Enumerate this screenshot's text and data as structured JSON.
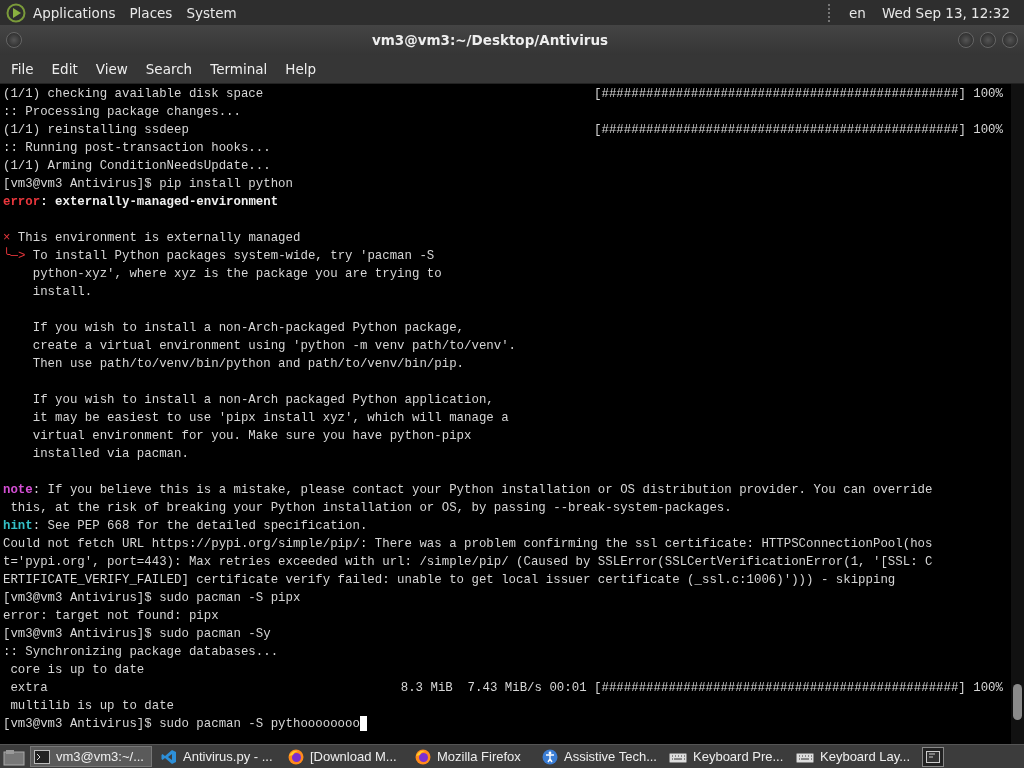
{
  "top_panel": {
    "menus": [
      "Applications",
      "Places",
      "System"
    ],
    "keyboard_layout": "en",
    "clock": "Wed Sep 13, 12:32"
  },
  "window": {
    "title": "vm3@vm3:~/Desktop/Antivirus",
    "menu": [
      "File",
      "Edit",
      "View",
      "Search",
      "Terminal",
      "Help"
    ]
  },
  "terminal": {
    "lines": [
      {
        "segments": [
          {
            "kind": "plain",
            "text": "(1/1) checking available disk space"
          },
          {
            "kind": "right",
            "text": "[################################################] 100%"
          }
        ]
      },
      {
        "segments": [
          {
            "kind": "plain",
            "text": ":: Processing package changes..."
          }
        ]
      },
      {
        "segments": [
          {
            "kind": "plain",
            "text": "(1/1) reinstalling ssdeep"
          },
          {
            "kind": "right",
            "text": "[################################################] 100%"
          }
        ]
      },
      {
        "segments": [
          {
            "kind": "plain",
            "text": ":: Running post-transaction hooks..."
          }
        ]
      },
      {
        "segments": [
          {
            "kind": "plain",
            "text": "(1/1) Arming ConditionNeedsUpdate..."
          }
        ]
      },
      {
        "segments": [
          {
            "kind": "plain",
            "text": "[vm3@vm3 Antivirus]$ pip install python"
          }
        ]
      },
      {
        "segments": [
          {
            "kind": "error",
            "text": "error"
          },
          {
            "kind": "bold",
            "text": ": externally-managed-environment"
          }
        ]
      },
      {
        "blank_before": true,
        "segments": [
          {
            "kind": "mark",
            "text": "×"
          },
          {
            "kind": "plain",
            "text": " This environment is externally managed"
          }
        ]
      },
      {
        "segments": [
          {
            "kind": "mark",
            "text": "╰─>"
          },
          {
            "kind": "plain",
            "text": " To install Python packages system-wide, try 'pacman -S"
          }
        ]
      },
      {
        "segments": [
          {
            "kind": "plain",
            "text": "    python-xyz', where xyz is the package you are trying to"
          }
        ]
      },
      {
        "segments": [
          {
            "kind": "plain",
            "text": "    install."
          }
        ]
      },
      {
        "blank_before": true,
        "segments": [
          {
            "kind": "plain",
            "text": "    If you wish to install a non-Arch-packaged Python package,"
          }
        ]
      },
      {
        "segments": [
          {
            "kind": "plain",
            "text": "    create a virtual environment using 'python -m venv path/to/venv'."
          }
        ]
      },
      {
        "segments": [
          {
            "kind": "plain",
            "text": "    Then use path/to/venv/bin/python and path/to/venv/bin/pip."
          }
        ]
      },
      {
        "blank_before": true,
        "segments": [
          {
            "kind": "plain",
            "text": "    If you wish to install a non-Arch packaged Python application,"
          }
        ]
      },
      {
        "segments": [
          {
            "kind": "plain",
            "text": "    it may be easiest to use 'pipx install xyz', which will manage a"
          }
        ]
      },
      {
        "segments": [
          {
            "kind": "plain",
            "text": "    virtual environment for you. Make sure you have python-pipx"
          }
        ]
      },
      {
        "segments": [
          {
            "kind": "plain",
            "text": "    installed via pacman."
          }
        ]
      },
      {
        "blank_before": true,
        "segments": [
          {
            "kind": "note",
            "text": "note"
          },
          {
            "kind": "plain",
            "text": ": If you believe this is a mistake, please contact your Python installation or OS distribution provider. You can override"
          }
        ]
      },
      {
        "segments": [
          {
            "kind": "plain",
            "text": " this, at the risk of breaking your Python installation or OS, by passing --break-system-packages."
          }
        ]
      },
      {
        "segments": [
          {
            "kind": "hint",
            "text": "hint"
          },
          {
            "kind": "plain",
            "text": ": See PEP 668 for the detailed specification."
          }
        ]
      },
      {
        "segments": [
          {
            "kind": "plain",
            "text": "Could not fetch URL https://pypi.org/simple/pip/: There was a problem confirming the ssl certificate: HTTPSConnectionPool(hos"
          }
        ]
      },
      {
        "segments": [
          {
            "kind": "plain",
            "text": "t='pypi.org', port=443): Max retries exceeded with url: /simple/pip/ (Caused by SSLError(SSLCertVerificationError(1, '[SSL: C"
          }
        ]
      },
      {
        "segments": [
          {
            "kind": "plain",
            "text": "ERTIFICATE_VERIFY_FAILED] certificate verify failed: unable to get local issuer certificate (_ssl.c:1006)'))) - skipping"
          }
        ]
      },
      {
        "segments": [
          {
            "kind": "plain",
            "text": "[vm3@vm3 Antivirus]$ sudo pacman -S pipx"
          }
        ]
      },
      {
        "segments": [
          {
            "kind": "plain",
            "text": "error: target not found: pipx"
          }
        ]
      },
      {
        "segments": [
          {
            "kind": "plain",
            "text": "[vm3@vm3 Antivirus]$ sudo pacman -Sy"
          }
        ]
      },
      {
        "segments": [
          {
            "kind": "plain",
            "text": ":: Synchronizing package databases..."
          }
        ]
      },
      {
        "segments": [
          {
            "kind": "plain",
            "text": " core is up to date"
          }
        ]
      },
      {
        "segments": [
          {
            "kind": "plain",
            "text": " extra"
          },
          {
            "kind": "right",
            "text": "8.3 MiB  7.43 MiB/s 00:01 [################################################] 100%"
          }
        ]
      },
      {
        "segments": [
          {
            "kind": "plain",
            "text": " multilib is up to date"
          }
        ]
      },
      {
        "segments": [
          {
            "kind": "plain",
            "text": "[vm3@vm3 Antivirus]$ sudo pacman -S pythoooooooo"
          },
          {
            "kind": "cursor"
          }
        ]
      }
    ]
  },
  "taskbar": {
    "items": [
      {
        "kind": "terminal",
        "label": "vm3@vm3:~/...",
        "selected": true
      },
      {
        "kind": "editor",
        "label": "Antivirus.py - ...",
        "selected": false
      },
      {
        "kind": "browser",
        "label": "[Download M...",
        "selected": false
      },
      {
        "kind": "browser",
        "label": "Mozilla Firefox",
        "selected": false
      },
      {
        "kind": "accessibility",
        "label": "Assistive Tech...",
        "selected": false
      },
      {
        "kind": "keyboard",
        "label": "Keyboard Pre...",
        "selected": false
      },
      {
        "kind": "keyboard",
        "label": "Keyboard Lay...",
        "selected": false
      }
    ]
  }
}
